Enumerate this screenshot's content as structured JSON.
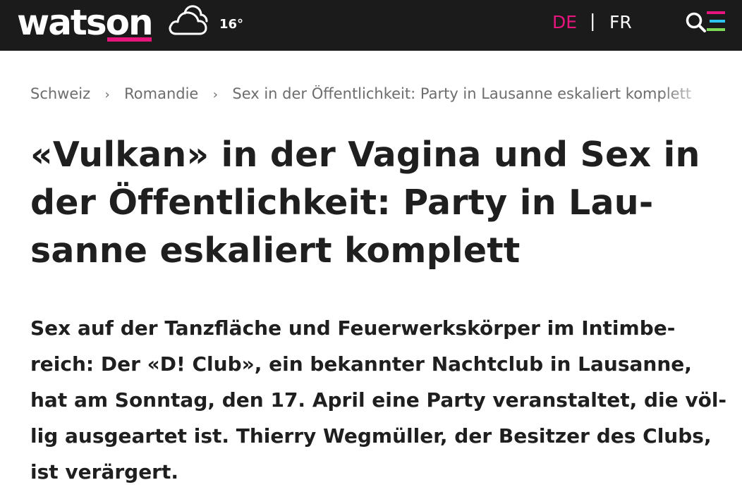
{
  "header": {
    "logo": "watson",
    "temperature": "16°",
    "weather_icon": "cloud-icon",
    "languages": {
      "active": "DE",
      "separator": "|",
      "other": "FR"
    },
    "menu_icon": "search-menu-icon",
    "colors": {
      "background": "#1b1b1b",
      "accent": "#e6157e",
      "menu_stripes": [
        "#e6157e",
        "#2ec4f0",
        "#7ed957"
      ]
    }
  },
  "breadcrumb": {
    "items": [
      "Schweiz",
      "Romandie",
      "Sex in der Öffentlichkeit: Party in Lausanne eskaliert komplett"
    ],
    "separator": "›"
  },
  "article": {
    "headline_lines": [
      "«Vulkan» in der Vagina und Sex in",
      "der Öffentlichkeit: Party in Lau-",
      "sanne eskaliert komplett"
    ],
    "lead_lines": [
      "Sex auf der Tanzfläche und Feuerwerkskörper im Intimbe-",
      "reich: Der «D! Club», ein bekannter Nachtclub in Lausanne,",
      "hat am Sonntag, den 17. April eine Party veranstaltet, die völ-",
      "lig ausgeartet ist. Thierry Wegmüller, der Besitzer des Clubs,",
      "ist verärgert."
    ]
  }
}
